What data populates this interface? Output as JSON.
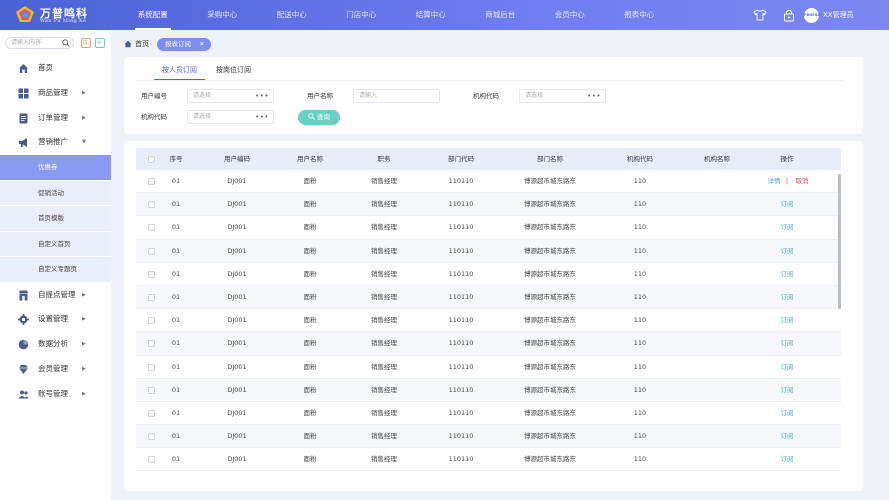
{
  "app": {
    "brand_name": "万普鸣科",
    "brand_sub": "Wan Pu Ming Ke"
  },
  "topnav": [
    {
      "label": "系统配置",
      "active": true
    },
    {
      "label": "采购中心",
      "active": false
    },
    {
      "label": "配送中心",
      "active": false
    },
    {
      "label": "门店中心",
      "active": false
    },
    {
      "label": "结算中心",
      "active": false
    },
    {
      "label": "商城后台",
      "active": false
    },
    {
      "label": "会员中心",
      "active": false
    },
    {
      "label": "报表中心",
      "active": false
    }
  ],
  "header_icons": [
    "shirt-icon",
    "lock-icon",
    "avatar"
  ],
  "user": {
    "avatar_text": "PROFILE",
    "name": "XX管理员"
  },
  "sidebar": {
    "search_placeholder": "请输入内容",
    "items": [
      {
        "label": "首页",
        "icon": "home-icon",
        "arrow": false
      },
      {
        "label": "商品管理",
        "icon": "grid-icon",
        "arrow": true
      },
      {
        "label": "订单管理",
        "icon": "order-icon",
        "arrow": true
      },
      {
        "label": "营销推广",
        "icon": "megaphone-icon",
        "arrow": true,
        "expanded": true
      }
    ],
    "subitems": [
      {
        "label": "优惠券",
        "active": true
      },
      {
        "label": "促销活动",
        "active": false
      },
      {
        "label": "首页模版",
        "active": false
      },
      {
        "label": "自定义首页",
        "active": false
      },
      {
        "label": "自定义专题页",
        "active": false
      }
    ],
    "items_after": [
      {
        "label": "自提点管理",
        "icon": "store-icon"
      },
      {
        "label": "设置管理",
        "icon": "gear-icon"
      },
      {
        "label": "数据分析",
        "icon": "pie-chart-icon"
      },
      {
        "label": "会员管理",
        "icon": "diamond-icon"
      },
      {
        "label": "账号管理",
        "icon": "users-icon"
      }
    ]
  },
  "breadcrumb": {
    "home": "首页",
    "tag": "报表订阅"
  },
  "tabs": [
    {
      "label": "按人员订阅",
      "active": true
    },
    {
      "label": "按岗位订阅",
      "active": false
    }
  ],
  "filters": {
    "user_code_label": "用户编号",
    "user_code_placeholder": "请选择",
    "user_name_label": "用户名称",
    "user_name_placeholder": "请输入",
    "org_code_label": "机构代码",
    "org_code_placeholder": "请选择",
    "org_code2_label": "机构代码",
    "org_code2_placeholder": "请选择",
    "search_button": "查询"
  },
  "table": {
    "columns": [
      "序号",
      "用户编码",
      "用户名称",
      "职务",
      "部门代码",
      "部门名称",
      "机构代码",
      "机构名称",
      "操作"
    ],
    "first_row_actions": {
      "detail": "详情",
      "sep": "|",
      "cancel": "取消"
    },
    "row_action": "订阅",
    "rows": [
      {
        "seq": "01",
        "user_code": "DJ001",
        "user_name": "面粉",
        "position": "销售经理",
        "dept_code": "110110",
        "dept_name": "博源超市城东路东",
        "org_code": "110",
        "org_name": ""
      },
      {
        "seq": "01",
        "user_code": "DJ001",
        "user_name": "面粉",
        "position": "销售经理",
        "dept_code": "110110",
        "dept_name": "博源超市城东路东",
        "org_code": "110",
        "org_name": ""
      },
      {
        "seq": "01",
        "user_code": "DJ001",
        "user_name": "面粉",
        "position": "销售经理",
        "dept_code": "110110",
        "dept_name": "博源超市城东路东",
        "org_code": "110",
        "org_name": ""
      },
      {
        "seq": "01",
        "user_code": "DJ001",
        "user_name": "面粉",
        "position": "销售经理",
        "dept_code": "110110",
        "dept_name": "博源超市城东路东",
        "org_code": "110",
        "org_name": ""
      },
      {
        "seq": "01",
        "user_code": "DJ001",
        "user_name": "面粉",
        "position": "销售经理",
        "dept_code": "110110",
        "dept_name": "博源超市城东路东",
        "org_code": "110",
        "org_name": ""
      },
      {
        "seq": "01",
        "user_code": "DJ001",
        "user_name": "面粉",
        "position": "销售经理",
        "dept_code": "110110",
        "dept_name": "博源超市城东路东",
        "org_code": "110",
        "org_name": ""
      },
      {
        "seq": "01",
        "user_code": "DJ001",
        "user_name": "面粉",
        "position": "销售经理",
        "dept_code": "110110",
        "dept_name": "博源超市城东路东",
        "org_code": "110",
        "org_name": ""
      },
      {
        "seq": "01",
        "user_code": "DJ001",
        "user_name": "面粉",
        "position": "销售经理",
        "dept_code": "110110",
        "dept_name": "博源超市城东路东",
        "org_code": "110",
        "org_name": ""
      },
      {
        "seq": "01",
        "user_code": "DJ001",
        "user_name": "面粉",
        "position": "销售经理",
        "dept_code": "110110",
        "dept_name": "博源超市城东路东",
        "org_code": "110",
        "org_name": ""
      },
      {
        "seq": "01",
        "user_code": "DJ001",
        "user_name": "面粉",
        "position": "销售经理",
        "dept_code": "110110",
        "dept_name": "博源超市城东路东",
        "org_code": "110",
        "org_name": ""
      },
      {
        "seq": "01",
        "user_code": "DJ001",
        "user_name": "面粉",
        "position": "销售经理",
        "dept_code": "110110",
        "dept_name": "博源超市城东路东",
        "org_code": "110",
        "org_name": ""
      },
      {
        "seq": "01",
        "user_code": "DJ001",
        "user_name": "面粉",
        "position": "销售经理",
        "dept_code": "110110",
        "dept_name": "博源超市城东路东",
        "org_code": "110",
        "org_name": ""
      },
      {
        "seq": "01",
        "user_code": "DJ001",
        "user_name": "面粉",
        "position": "销售经理",
        "dept_code": "110110",
        "dept_name": "博源超市城东路东",
        "org_code": "110",
        "org_name": ""
      }
    ]
  },
  "colors": {
    "primary": "#5b6fe0",
    "accent_teal": "#6ccfc2",
    "link_teal": "#4aaeb8",
    "danger": "#e2474f",
    "active_submenu": "#8a9af0"
  }
}
